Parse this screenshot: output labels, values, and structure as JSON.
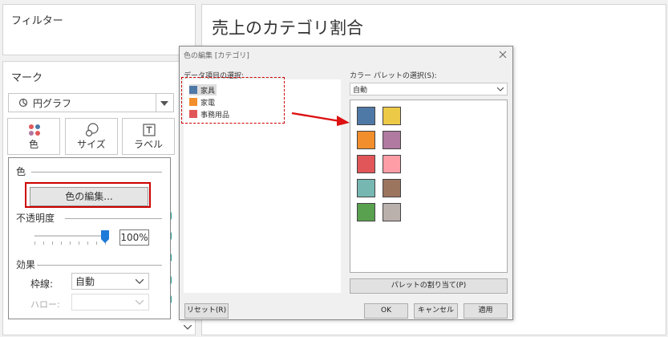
{
  "filters": {
    "title": "フィルター"
  },
  "marks": {
    "title": "マーク",
    "type_selected": "円グラフ",
    "buttons": [
      {
        "label": "色",
        "icon": "color-dots-icon"
      },
      {
        "label": "サイズ",
        "icon": "size-circles-icon"
      },
      {
        "label": "ラベル",
        "icon": "label-t-icon"
      }
    ]
  },
  "color_popover": {
    "section_color": "色",
    "edit_colors_button": "色の編集...",
    "section_opacity": "不透明度",
    "opacity_value": "100%",
    "opacity_level": 1.0,
    "section_effects": "効果",
    "border_label": "枠線:",
    "border_value": "自動",
    "halo_label": "ハロー:",
    "halo_value": ""
  },
  "sheet": {
    "title": "売上のカテゴリ割合"
  },
  "dialog": {
    "title": "色の編集 [カテゴリ]",
    "data_items_label": "データ項目の選択:",
    "data_items": [
      {
        "label": "家具",
        "color": "#4e79a7",
        "selected": true
      },
      {
        "label": "家電",
        "color": "#f28e2b",
        "selected": false
      },
      {
        "label": "事務用品",
        "color": "#e15759",
        "selected": false
      }
    ],
    "palette_label": "カラー パレットの選択(S):",
    "palette_value": "自動",
    "palette_colors": [
      "#4e79a7",
      "#edc948",
      "#f28e2b",
      "#b07aa1",
      "#e15759",
      "#ff9da7",
      "#76b7b2",
      "#9c755f",
      "#59a14f",
      "#bab0ac"
    ],
    "assign_palette_button": "パレットの割り当て(P)",
    "reset_button": "リセット(R)",
    "ok_button": "OK",
    "cancel_button": "キャンセル",
    "apply_button": "適用"
  },
  "colors": {
    "highlight_box": "#cc0000",
    "arrow": "#dd1111",
    "slider_thumb": "#1e7ad8"
  }
}
